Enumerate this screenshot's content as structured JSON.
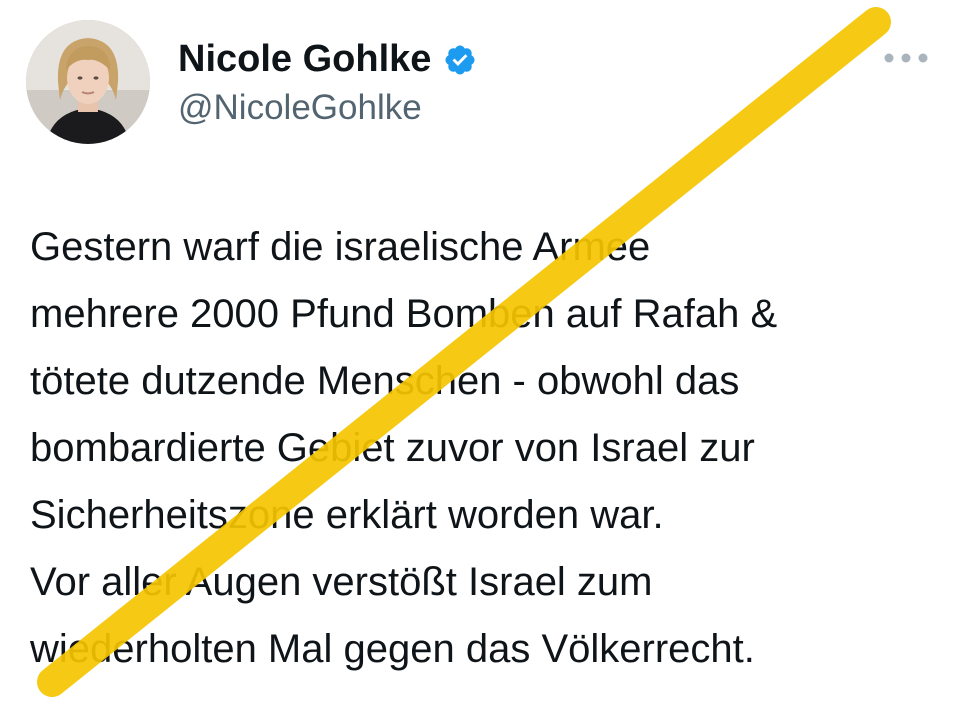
{
  "author": {
    "display_name": "Nicole Gohlke",
    "handle": "@NicoleGohlke",
    "verified": true,
    "avatar_icon": "profile-photo",
    "verified_icon": "verified-check-icon"
  },
  "actions": {
    "more_icon": "more-horizontal-icon"
  },
  "tweet": {
    "lines": [
      "Gestern warf die israelische Armee",
      "mehrere 2000 Pfund Bomben auf Rafah &",
      "tötete dutzende Menschen - obwohl das",
      "bombardierte Gebiet zuvor von Israel zur",
      "Sicherheitszone erklärt worden war.",
      "Vor aller Augen verstößt Israel zum",
      "wiederholten Mal gegen das Völkerrecht."
    ]
  },
  "colors": {
    "text": "#0f1419",
    "secondary_text": "#536471",
    "verified_blue": "#1d9bf0",
    "strike_yellow": "#f5c400"
  }
}
